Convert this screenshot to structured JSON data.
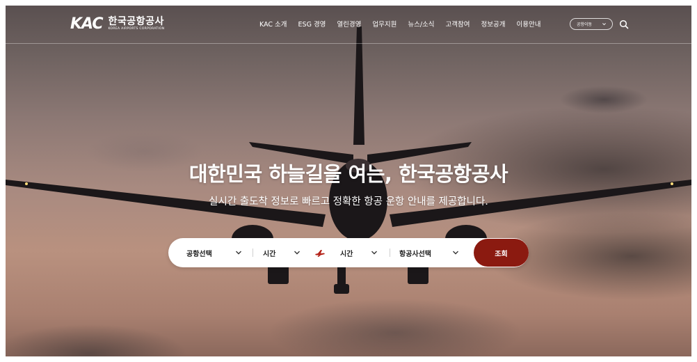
{
  "header": {
    "logo_mark": "KAC",
    "logo_ko": "한국공항공사",
    "logo_en": "KOREA AIRPORTS CORPORATION",
    "nav": [
      "KAC 소개",
      "ESG 경영",
      "열린경영",
      "업무지원",
      "뉴스/소식",
      "고객참여",
      "정보공개",
      "이용안내"
    ],
    "airport_button": "공항이동",
    "search_icon": "search-icon"
  },
  "hero": {
    "title": "대한민국 하늘길을 여는, 한국공항공사",
    "subtitle": "실시간 출도착 정보로 빠르고 정확한 항공 운항 안내를 제공합니다."
  },
  "search": {
    "airport": "공항선택",
    "time_from": "시간",
    "time_to": "시간",
    "airline": "항공사선택",
    "submit": "조회",
    "accent": "#8b1a10"
  }
}
